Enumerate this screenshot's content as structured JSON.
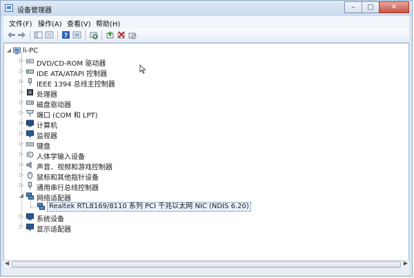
{
  "window": {
    "title": "设备管理器",
    "controls": {
      "minimize": "–",
      "maximize": "□",
      "close": "✕"
    }
  },
  "menu": [
    {
      "label": "文件(F)"
    },
    {
      "label": "操作(A)"
    },
    {
      "label": "查看(V)"
    },
    {
      "label": "帮助(H)"
    }
  ],
  "toolbar": {
    "icons": [
      "back-arrow-icon",
      "forward-arrow-icon",
      "show-hide-tree-icon",
      "properties-icon",
      "help-icon",
      "show-view-icon",
      "scan-hardware-icon",
      "update-driver-icon",
      "uninstall-icon",
      "disable-icon"
    ]
  },
  "tree": {
    "root": {
      "label": "li-PC",
      "expanded": true
    },
    "categories": [
      {
        "label": "DVD/CD-ROM 驱动器",
        "icon": "dvd-icon",
        "expanded": false
      },
      {
        "label": "IDE ATA/ATAPI 控制器",
        "icon": "ide-controller-icon",
        "expanded": false
      },
      {
        "label": "IEEE 1394 总线主控制器",
        "icon": "ieee1394-icon",
        "expanded": false
      },
      {
        "label": "处理器",
        "icon": "processor-icon",
        "expanded": false
      },
      {
        "label": "磁盘驱动器",
        "icon": "disk-drive-icon",
        "expanded": false
      },
      {
        "label": "端口 (COM 和 LPT)",
        "icon": "port-icon",
        "expanded": false
      },
      {
        "label": "计算机",
        "icon": "computer-icon",
        "expanded": false
      },
      {
        "label": "监视器",
        "icon": "monitor-icon",
        "expanded": false
      },
      {
        "label": "键盘",
        "icon": "keyboard-icon",
        "expanded": false
      },
      {
        "label": "人体学输入设备",
        "icon": "hid-icon",
        "expanded": false
      },
      {
        "label": "声音、视频和游戏控制器",
        "icon": "sound-icon",
        "expanded": false
      },
      {
        "label": "鼠标和其他指针设备",
        "icon": "mouse-icon",
        "expanded": false
      },
      {
        "label": "通用串行总线控制器",
        "icon": "usb-icon",
        "expanded": false
      },
      {
        "label": "网络适配器",
        "icon": "network-adapter-icon",
        "expanded": true,
        "children": [
          {
            "label": "Realtek RTL8169/8110 系列 PCI 千兆以太网 NIC (NDIS 6.20)",
            "icon": "network-card-icon",
            "selected": true
          }
        ]
      },
      {
        "label": "系统设备",
        "icon": "system-device-icon",
        "expanded": false
      },
      {
        "label": "显示适配器",
        "icon": "display-adapter-icon",
        "expanded": false
      }
    ]
  },
  "colors": {
    "titlebar": "#c9d9ee",
    "selection": "#e8f1fb",
    "close": "#c85442"
  }
}
